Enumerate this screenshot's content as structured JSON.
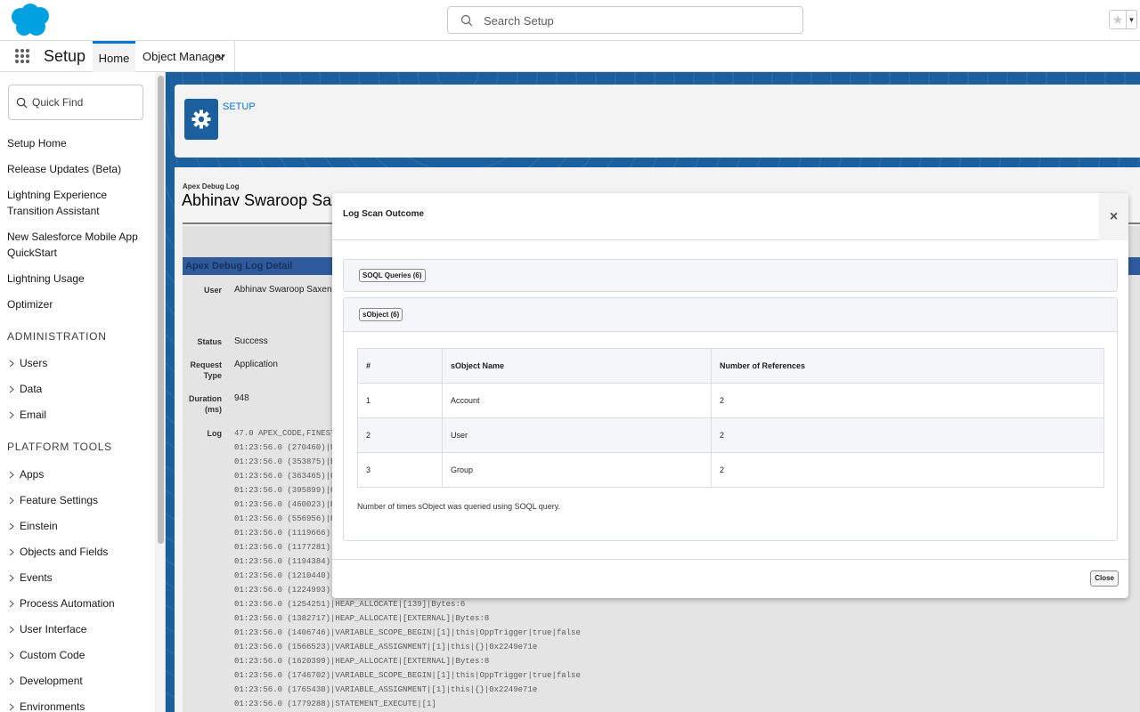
{
  "header": {
    "search_placeholder": "Search Setup"
  },
  "nav": {
    "app_name": "Setup",
    "tabs": [
      {
        "label": "Home",
        "active": true
      },
      {
        "label": "Object Manager",
        "active": false
      }
    ]
  },
  "sidebar": {
    "quick_find_placeholder": "Quick Find",
    "top_links": [
      "Setup Home",
      "Release Updates (Beta)",
      "Lightning Experience Transition Assistant",
      "New Salesforce Mobile App QuickStart",
      "Lightning Usage",
      "Optimizer"
    ],
    "sections": [
      {
        "title": "ADMINISTRATION",
        "items": [
          "Users",
          "Data",
          "Email"
        ]
      },
      {
        "title": "PLATFORM TOOLS",
        "items": [
          "Apps",
          "Feature Settings",
          "Einstein",
          "Objects and Fields",
          "Events",
          "Process Automation",
          "User Interface",
          "Custom Code",
          "Development",
          "Environments"
        ]
      }
    ]
  },
  "setup_header": {
    "breadcrumb": "SETUP"
  },
  "log_page": {
    "eyebrow": "Apex Debug Log",
    "title": "Abhinav Swaroop Saxena",
    "detail_heading": "Apex Debug Log Detail",
    "fields": [
      {
        "label": "User",
        "value": "Abhinav Swaroop Saxena"
      },
      {
        "label": "Status",
        "value": "Success"
      },
      {
        "label": "Request Type",
        "value": "Application"
      },
      {
        "label": "Duration (ms)",
        "value": "948"
      },
      {
        "label": "Log",
        "value": ""
      }
    ],
    "log_lines": [
      "47.0 APEX_CODE,FINEST;AP",
      "01:23:56.0 (270460)|USE",
      "01:23:56.0 (353875)|EXE",
      "01:23:56.0 (363465)|COD",
      "01:23:56.0 (395899)|COD",
      "01:23:56.0 (460023)|HEA",
      "01:23:56.0 (556956)|HEA",
      "01:23:56.0 (1119666)|HE",
      "01:23:56.0 (1177281)|HE",
      "01:23:56.0 (1194384)|HE",
      "01:23:56.0 (1210440)|HE",
      "01:23:56.0 (1224993)|HE",
      "01:23:56.0 (1254251)|HEAP_ALLOCATE|[139]|Bytes:6",
      "01:23:56.0 (1382717)|HEAP_ALLOCATE|[EXTERNAL]|Bytes:8",
      "01:23:56.0 (1406746)|VARIABLE_SCOPE_BEGIN|[1]|this|OppTrigger|true|false",
      "01:23:56.0 (1566523)|VARIABLE_ASSIGNMENT|[1]|this|{}|0x2249e71e",
      "01:23:56.0 (1620399)|HEAP_ALLOCATE|[EXTERNAL]|Bytes:8",
      "01:23:56.0 (1746702)|VARIABLE_SCOPE_BEGIN|[1]|this|OppTrigger|true|false",
      "01:23:56.0 (1765430)|VARIABLE_ASSIGNMENT|[1]|this|{}|0x2249e71e",
      "01:23:56.0 (1779288)|STATEMENT_EXECUTE|[1]"
    ]
  },
  "modal": {
    "title": "Log Scan Outcome",
    "close_symbol": "×",
    "accordions": [
      {
        "label": "SOQL Queries (6)"
      },
      {
        "label": "sObject (6)"
      }
    ],
    "table": {
      "headers": [
        "#",
        "sObject Name",
        "Number of References"
      ],
      "rows": [
        [
          "1",
          "Account",
          "2"
        ],
        [
          "2",
          "User",
          "2"
        ],
        [
          "3",
          "Group",
          "2"
        ]
      ]
    },
    "note": "Number of times sObject was queried using SOQL query.",
    "close_label": "Close"
  },
  "colors": {
    "brand_blue": "#00a1e0",
    "accent_blue": "#0176d3",
    "setup_bg": "#1b5f9e"
  }
}
